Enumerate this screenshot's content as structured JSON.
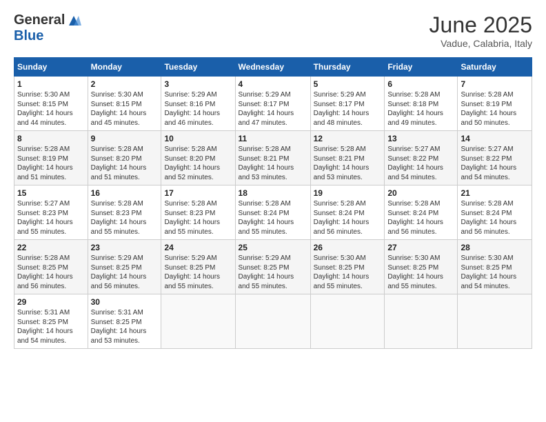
{
  "header": {
    "logo_general": "General",
    "logo_blue": "Blue",
    "month_title": "June 2025",
    "subtitle": "Vadue, Calabria, Italy"
  },
  "weekdays": [
    "Sunday",
    "Monday",
    "Tuesday",
    "Wednesday",
    "Thursday",
    "Friday",
    "Saturday"
  ],
  "rows": [
    [
      {
        "day": "1",
        "lines": [
          "Sunrise: 5:30 AM",
          "Sunset: 8:15 PM",
          "Daylight: 14 hours",
          "and 44 minutes."
        ]
      },
      {
        "day": "2",
        "lines": [
          "Sunrise: 5:30 AM",
          "Sunset: 8:15 PM",
          "Daylight: 14 hours",
          "and 45 minutes."
        ]
      },
      {
        "day": "3",
        "lines": [
          "Sunrise: 5:29 AM",
          "Sunset: 8:16 PM",
          "Daylight: 14 hours",
          "and 46 minutes."
        ]
      },
      {
        "day": "4",
        "lines": [
          "Sunrise: 5:29 AM",
          "Sunset: 8:17 PM",
          "Daylight: 14 hours",
          "and 47 minutes."
        ]
      },
      {
        "day": "5",
        "lines": [
          "Sunrise: 5:29 AM",
          "Sunset: 8:17 PM",
          "Daylight: 14 hours",
          "and 48 minutes."
        ]
      },
      {
        "day": "6",
        "lines": [
          "Sunrise: 5:28 AM",
          "Sunset: 8:18 PM",
          "Daylight: 14 hours",
          "and 49 minutes."
        ]
      },
      {
        "day": "7",
        "lines": [
          "Sunrise: 5:28 AM",
          "Sunset: 8:19 PM",
          "Daylight: 14 hours",
          "and 50 minutes."
        ]
      }
    ],
    [
      {
        "day": "8",
        "lines": [
          "Sunrise: 5:28 AM",
          "Sunset: 8:19 PM",
          "Daylight: 14 hours",
          "and 51 minutes."
        ]
      },
      {
        "day": "9",
        "lines": [
          "Sunrise: 5:28 AM",
          "Sunset: 8:20 PM",
          "Daylight: 14 hours",
          "and 51 minutes."
        ]
      },
      {
        "day": "10",
        "lines": [
          "Sunrise: 5:28 AM",
          "Sunset: 8:20 PM",
          "Daylight: 14 hours",
          "and 52 minutes."
        ]
      },
      {
        "day": "11",
        "lines": [
          "Sunrise: 5:28 AM",
          "Sunset: 8:21 PM",
          "Daylight: 14 hours",
          "and 53 minutes."
        ]
      },
      {
        "day": "12",
        "lines": [
          "Sunrise: 5:28 AM",
          "Sunset: 8:21 PM",
          "Daylight: 14 hours",
          "and 53 minutes."
        ]
      },
      {
        "day": "13",
        "lines": [
          "Sunrise: 5:27 AM",
          "Sunset: 8:22 PM",
          "Daylight: 14 hours",
          "and 54 minutes."
        ]
      },
      {
        "day": "14",
        "lines": [
          "Sunrise: 5:27 AM",
          "Sunset: 8:22 PM",
          "Daylight: 14 hours",
          "and 54 minutes."
        ]
      }
    ],
    [
      {
        "day": "15",
        "lines": [
          "Sunrise: 5:27 AM",
          "Sunset: 8:23 PM",
          "Daylight: 14 hours",
          "and 55 minutes."
        ]
      },
      {
        "day": "16",
        "lines": [
          "Sunrise: 5:28 AM",
          "Sunset: 8:23 PM",
          "Daylight: 14 hours",
          "and 55 minutes."
        ]
      },
      {
        "day": "17",
        "lines": [
          "Sunrise: 5:28 AM",
          "Sunset: 8:23 PM",
          "Daylight: 14 hours",
          "and 55 minutes."
        ]
      },
      {
        "day": "18",
        "lines": [
          "Sunrise: 5:28 AM",
          "Sunset: 8:24 PM",
          "Daylight: 14 hours",
          "and 55 minutes."
        ]
      },
      {
        "day": "19",
        "lines": [
          "Sunrise: 5:28 AM",
          "Sunset: 8:24 PM",
          "Daylight: 14 hours",
          "and 56 minutes."
        ]
      },
      {
        "day": "20",
        "lines": [
          "Sunrise: 5:28 AM",
          "Sunset: 8:24 PM",
          "Daylight: 14 hours",
          "and 56 minutes."
        ]
      },
      {
        "day": "21",
        "lines": [
          "Sunrise: 5:28 AM",
          "Sunset: 8:24 PM",
          "Daylight: 14 hours",
          "and 56 minutes."
        ]
      }
    ],
    [
      {
        "day": "22",
        "lines": [
          "Sunrise: 5:28 AM",
          "Sunset: 8:25 PM",
          "Daylight: 14 hours",
          "and 56 minutes."
        ]
      },
      {
        "day": "23",
        "lines": [
          "Sunrise: 5:29 AM",
          "Sunset: 8:25 PM",
          "Daylight: 14 hours",
          "and 56 minutes."
        ]
      },
      {
        "day": "24",
        "lines": [
          "Sunrise: 5:29 AM",
          "Sunset: 8:25 PM",
          "Daylight: 14 hours",
          "and 55 minutes."
        ]
      },
      {
        "day": "25",
        "lines": [
          "Sunrise: 5:29 AM",
          "Sunset: 8:25 PM",
          "Daylight: 14 hours",
          "and 55 minutes."
        ]
      },
      {
        "day": "26",
        "lines": [
          "Sunrise: 5:30 AM",
          "Sunset: 8:25 PM",
          "Daylight: 14 hours",
          "and 55 minutes."
        ]
      },
      {
        "day": "27",
        "lines": [
          "Sunrise: 5:30 AM",
          "Sunset: 8:25 PM",
          "Daylight: 14 hours",
          "and 55 minutes."
        ]
      },
      {
        "day": "28",
        "lines": [
          "Sunrise: 5:30 AM",
          "Sunset: 8:25 PM",
          "Daylight: 14 hours",
          "and 54 minutes."
        ]
      }
    ],
    [
      {
        "day": "29",
        "lines": [
          "Sunrise: 5:31 AM",
          "Sunset: 8:25 PM",
          "Daylight: 14 hours",
          "and 54 minutes."
        ]
      },
      {
        "day": "30",
        "lines": [
          "Sunrise: 5:31 AM",
          "Sunset: 8:25 PM",
          "Daylight: 14 hours",
          "and 53 minutes."
        ]
      },
      null,
      null,
      null,
      null,
      null
    ]
  ]
}
